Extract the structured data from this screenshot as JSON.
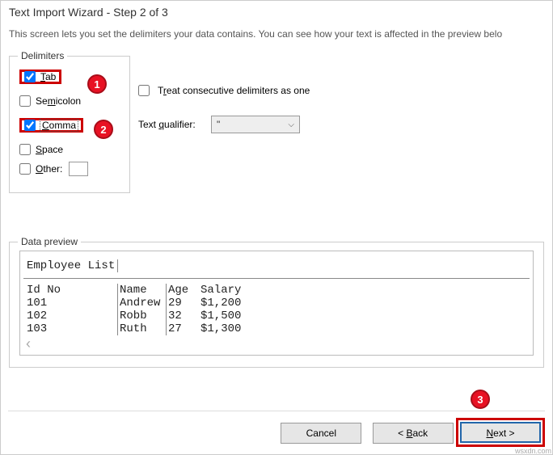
{
  "title": "Text Import Wizard - Step 2 of 3",
  "intro": "This screen lets you set the delimiters your data contains.  You can see how your text is affected in the preview belo",
  "delimiters": {
    "group_label": "Delimiters",
    "tab": "Tab",
    "semicolon": "Semicolon",
    "comma": "Comma",
    "space": "Space",
    "other": "Other:"
  },
  "options": {
    "consecutive": "Treat consecutive delimiters as one",
    "qualifier_label": "Text qualifier:",
    "qualifier_value": "\""
  },
  "badges": {
    "b1": "1",
    "b2": "2",
    "b3": "3"
  },
  "preview": {
    "group_label": "Data preview",
    "headers": [
      "Employee List",
      "",
      "",
      "",
      ""
    ],
    "cols": [
      "Id No",
      "Name",
      "Age",
      "Salary"
    ],
    "rows": [
      [
        "101",
        "Andrew",
        "29",
        "$1,200"
      ],
      [
        "102",
        "Robb",
        "32",
        "$1,500"
      ],
      [
        "103",
        "Ruth",
        "27",
        "$1,300"
      ]
    ]
  },
  "buttons": {
    "cancel": "Cancel",
    "back": "< Back",
    "next": "Next >"
  },
  "watermark": "wsxdn.com"
}
